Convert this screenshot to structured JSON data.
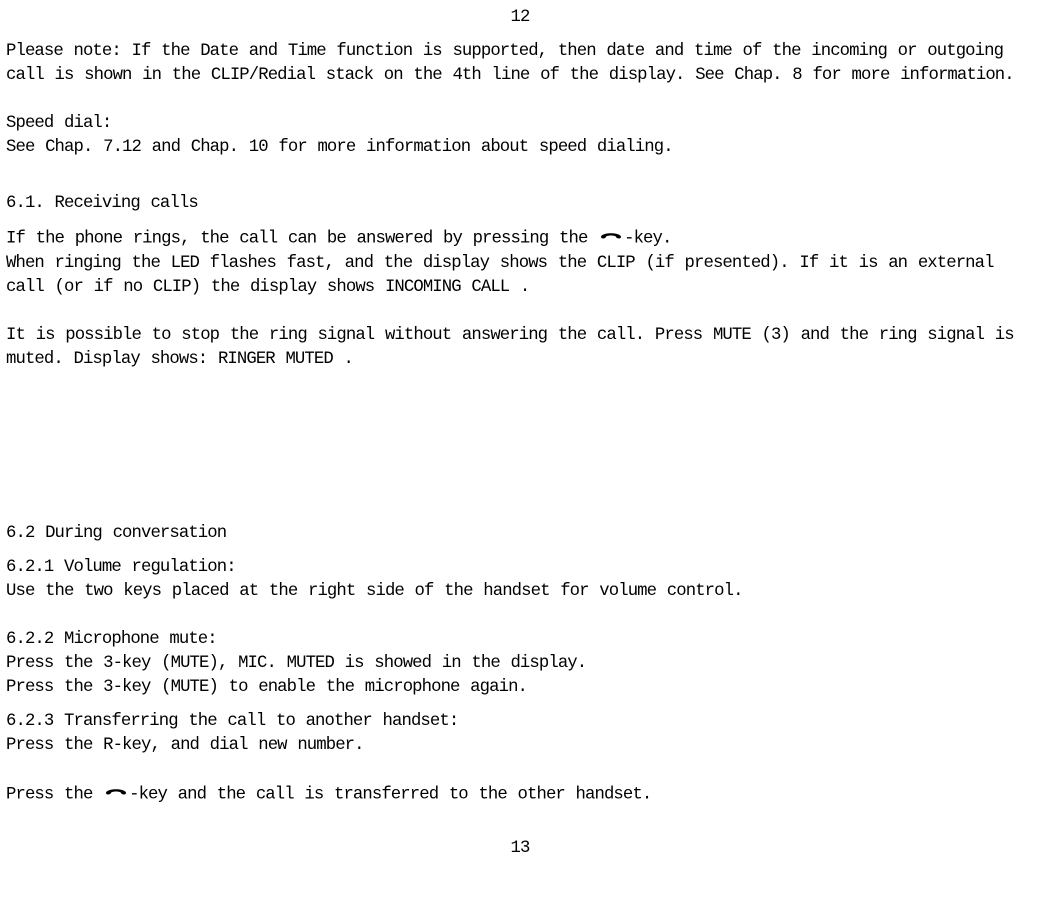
{
  "page_num_top": "12",
  "page_num_bottom": "13",
  "intro_note": "Please note: If the Date and Time function is supported, then date and time of the incoming or outgoing call is shown in the CLIP/Redial stack on the 4th line of the display. See Chap. 8 for more information.",
  "speed_dial_title": "Speed dial:",
  "speed_dial_body": "See Chap. 7.12 and Chap. 10 for more information about speed dialing.",
  "sec61_title": "6.1. Receiving calls",
  "sec61_line1a": "If the phone rings, the call can be answered by pressing the ",
  "sec61_line1b": "-key.",
  "sec61_line2": "When ringing the LED flashes fast, and the display shows the CLIP (if presented). If it is an external call (or if no CLIP) the display shows  INCOMING CALL .",
  "sec61_line3": "It is possible to stop the ring signal without answering the call. Press MUTE (3) and the ring signal is muted. Display shows:  RINGER MUTED .",
  "sec62_title": "6.2 During conversation",
  "sec621_title": "6.2.1 Volume regulation:",
  "sec621_body": "Use the two keys placed at the right side of the handset for volume control.",
  "sec622_title": "6.2.2 Microphone mute:",
  "sec622_l1": "Press the 3-key (MUTE),  MIC. MUTED  is showed in the display.",
  "sec622_l2": "Press the 3-key (MUTE) to enable the microphone again.",
  "sec623_title": "6.2.3 Transferring the call to another handset:",
  "sec623_l1": "Press the R-key, and dial new number.",
  "sec623_l2a": "Press the ",
  "sec623_l2b": "-key and the call is transferred to the other handset."
}
